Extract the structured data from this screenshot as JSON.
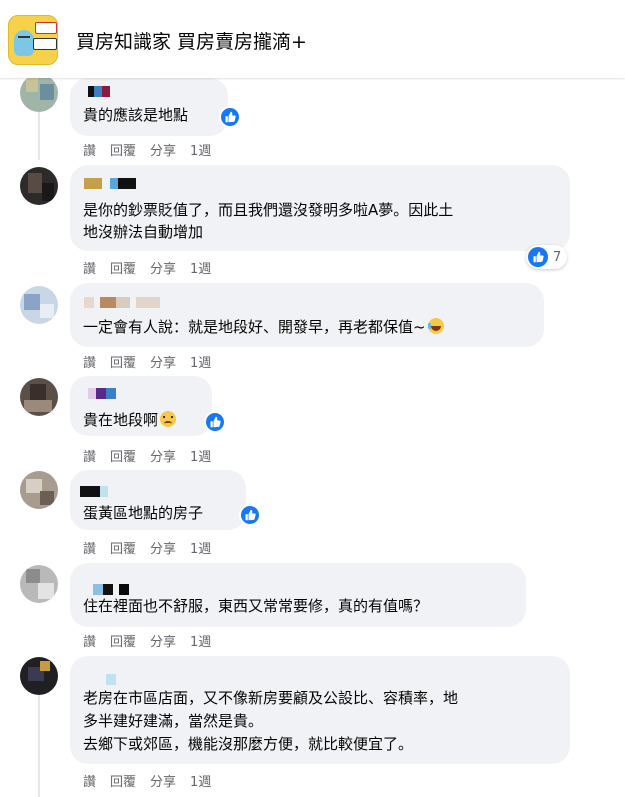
{
  "header": {
    "title": "買房知識家 買房賣房攏滴+"
  },
  "colors": {
    "like_blue": "#1877f2",
    "bubble_bg": "#f0f2f5",
    "meta_text": "#65676b"
  },
  "comments": [
    {
      "text_lines": [
        "貴的應該是地點"
      ],
      "actions": {
        "read": "讚",
        "reply": "回覆",
        "share": "分享",
        "time": "1週"
      },
      "reaction": "like"
    },
    {
      "text_lines": [
        "是你的鈔票貶值了，而且我們還沒發明多啦A夢。因此土",
        "地沒辦法自動增加"
      ],
      "actions": {
        "read": "讚",
        "reply": "回覆",
        "share": "分享",
        "time": "1週"
      },
      "reaction": "like",
      "reaction_count": "7"
    },
    {
      "text_lines": [
        "一定會有人說：就是地段好、開發早，再老都保值~"
      ],
      "emoji": "laughing-emoji",
      "actions": {
        "read": "讚",
        "reply": "回覆",
        "share": "分享",
        "time": "1週"
      }
    },
    {
      "text_lines": [
        "貴在地段啊"
      ],
      "emoji": "crying-emoji",
      "actions": {
        "read": "讚",
        "reply": "回覆",
        "share": "分享",
        "time": "1週"
      },
      "reaction": "like"
    },
    {
      "text_lines": [
        "蛋黃區地點的房子"
      ],
      "actions": {
        "read": "讚",
        "reply": "回覆",
        "share": "分享",
        "time": "1週"
      },
      "reaction": "like"
    },
    {
      "text_lines": [
        "住在裡面也不舒服，東西又常常要修，真的有值嗎？"
      ],
      "actions": {
        "read": "讚",
        "reply": "回覆",
        "share": "分享",
        "time": "1週"
      }
    },
    {
      "text_lines": [
        "老房在市區店面，又不像新房要顧及公設比、容積率，地",
        "多半建好建滿，當然是貴。",
        "去鄉下或郊區，機能沒那麼方便，就比較便宜了。"
      ],
      "actions": {
        "read": "讚",
        "reply": "回覆",
        "share": "分享",
        "time": "1週"
      }
    }
  ]
}
